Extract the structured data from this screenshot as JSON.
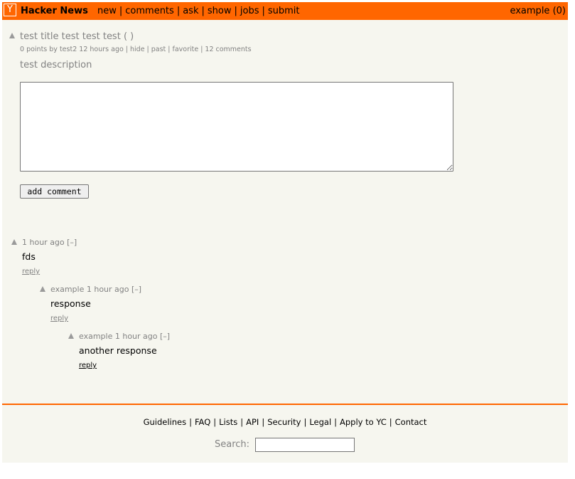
{
  "header": {
    "logo": "Y",
    "site_name": "Hacker News",
    "nav": [
      "new",
      "comments",
      "ask",
      "show",
      "jobs",
      "submit"
    ],
    "user": "example",
    "karma": "(0)"
  },
  "story": {
    "title": "test title test test test",
    "site": "( )",
    "points": "0 points by",
    "author": "test2",
    "age": "12 hours ago",
    "links": [
      "hide",
      "past",
      "favorite",
      "12 comments"
    ],
    "text": "test description"
  },
  "comment_form": {
    "button_label": "add comment"
  },
  "comments": [
    {
      "user": "",
      "age": "1 hour ago",
      "toggle": "[–]",
      "text": "fds",
      "reply": "reply",
      "reply_color": "#828282"
    },
    {
      "user": "example",
      "age": "1 hour ago",
      "toggle": "[–]",
      "text": "response",
      "reply": "reply",
      "reply_color": "#828282"
    },
    {
      "user": "example",
      "age": "1 hour ago",
      "toggle": "[–]",
      "text": "another response",
      "reply": "reply",
      "reply_color": "#000000"
    }
  ],
  "footer": {
    "links": [
      "Guidelines",
      "FAQ",
      "Lists",
      "API",
      "Security",
      "Legal",
      "Apply to YC",
      "Contact"
    ],
    "search_label": "Search:"
  },
  "colors": {
    "accent": "#ff6600",
    "background": "#f6f6ef",
    "muted": "#828282"
  }
}
